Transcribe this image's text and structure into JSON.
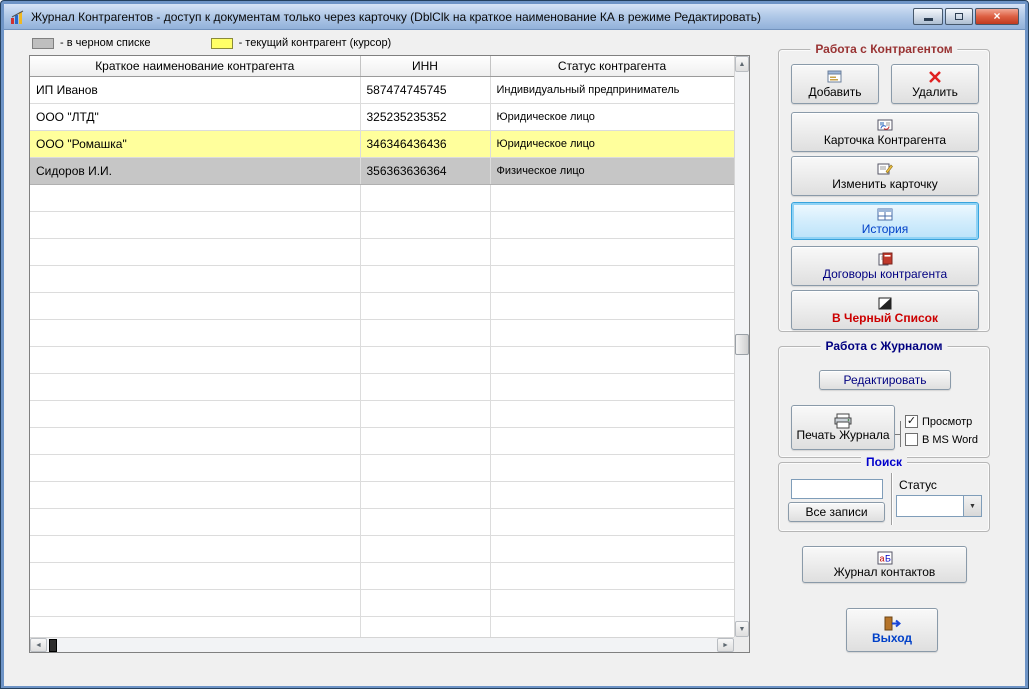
{
  "window": {
    "title": "Журнал Контрагентов - доступ к документам только через карточку (DblClk на краткое наименование КА в режиме Редактировать)"
  },
  "legend": {
    "blacklist": {
      "label": "- в черном списке",
      "color": "#BFBFBF"
    },
    "current": {
      "label": "- текущий контрагент (курсор)",
      "color": "#FFFF66"
    }
  },
  "table": {
    "columns": [
      {
        "key": "name",
        "label": "Краткое наименование контрагента"
      },
      {
        "key": "inn",
        "label": "ИНН"
      },
      {
        "key": "status",
        "label": "Статус контрагента"
      }
    ],
    "rows": [
      {
        "name": "ИП Иванов",
        "inn": "587474745745",
        "status": "Индивидуальный предприниматель",
        "type": "normal"
      },
      {
        "name": "ООО \"ЛТД\"",
        "inn": "325235235352",
        "status": "Юридическое лицо",
        "type": "normal"
      },
      {
        "name": "ООО \"Ромашка\"",
        "inn": "346346436436",
        "status": "Юридическое лицо",
        "type": "current"
      },
      {
        "name": "Сидоров И.И.",
        "inn": "356363636364",
        "status": "Физическое лицо",
        "type": "blacklist"
      }
    ],
    "row_colors": {
      "normal": "#FFFFFF",
      "current": "#FFFF9C",
      "blacklist": "#C6C6C6"
    }
  },
  "contractor_panel": {
    "title": "Работа с Контрагентом",
    "buttons": {
      "add": "Добавить",
      "delete": "Удалить",
      "card": "Карточка Контрагента",
      "edit_card": "Изменить карточку",
      "history": "История",
      "contracts": "Договоры контрагента",
      "blacklist": "В Черный Список"
    }
  },
  "journal_panel": {
    "title": "Работа с Журналом",
    "edit": "Редактировать",
    "print": "Печать Журнала",
    "preview": "Просмотр",
    "msword": "В MS Word",
    "preview_checked": true,
    "msword_checked": false
  },
  "search_panel": {
    "title": "Поиск",
    "query_value": "",
    "all_records": "Все записи",
    "status_label": "Статус",
    "status_value": ""
  },
  "contacts_button": "Журнал контактов",
  "exit_button": "Выход",
  "colors": {
    "highlight_row": "#FFFF9C",
    "blacklist_row": "#C6C6C6",
    "accent_blue": "#0040C8",
    "danger_red": "#CC0000",
    "navy": "#000080",
    "group_title_red": "#993333",
    "group_title_blue": "#0000CC",
    "history_selected_border": "#38A3DC"
  }
}
